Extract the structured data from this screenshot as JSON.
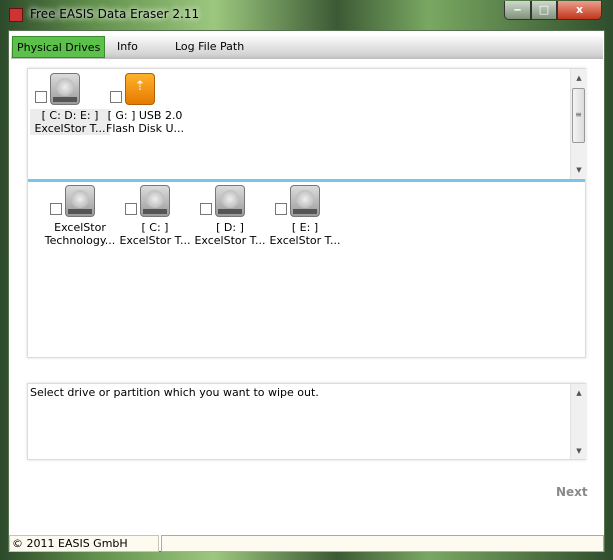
{
  "window": {
    "title": "Free EASIS Data Eraser 2.11",
    "minimize": "‒",
    "maximize": "□",
    "close": "x"
  },
  "tabs": [
    {
      "label": "Physical Drives",
      "active": true
    },
    {
      "label": "Info"
    },
    {
      "label": "Log File Path"
    }
  ],
  "physical_drives": [
    {
      "line1": "[ C: D: E: ]",
      "line2": "ExcelStor T...",
      "icon": "hard-drive-icon",
      "selected": true
    },
    {
      "line1": "[ G:  ] USB 2.0",
      "line2": "Flash Disk U...",
      "icon": "usb-drive-icon"
    }
  ],
  "partitions": [
    {
      "line1": "ExcelStor",
      "line2": "Technology..."
    },
    {
      "line1": "[ C: ]",
      "line2": "ExcelStor T..."
    },
    {
      "line1": "[ D: ]",
      "line2": "ExcelStor T..."
    },
    {
      "line1": "[ E: ]",
      "line2": "ExcelStor T..."
    }
  ],
  "message": "Select drive or partition which you want to wipe out.",
  "next_label": "Next",
  "status": {
    "copyright": "© 2011 EASIS GmbH"
  },
  "scroll": {
    "up": "▲",
    "down": "▼",
    "grip": "≡"
  },
  "usb_glyph": "⇡"
}
